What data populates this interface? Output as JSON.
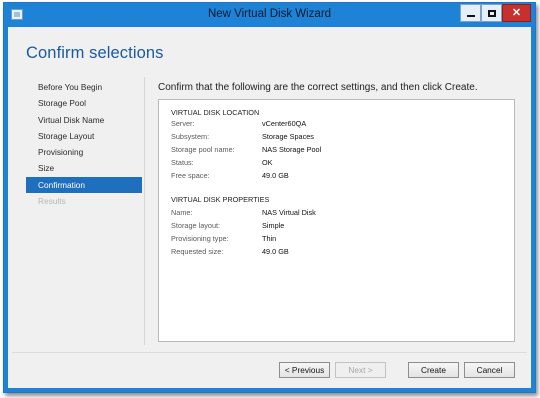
{
  "window": {
    "title": "New Virtual Disk Wizard",
    "close_glyph": "✕"
  },
  "page": {
    "title": "Confirm selections",
    "instruction": "Confirm that the following are the correct settings, and then click Create."
  },
  "nav": {
    "items": [
      {
        "label": "Before You Begin",
        "state": "normal"
      },
      {
        "label": "Storage Pool",
        "state": "normal"
      },
      {
        "label": "Virtual Disk Name",
        "state": "normal"
      },
      {
        "label": "Storage Layout",
        "state": "normal"
      },
      {
        "label": "Provisioning",
        "state": "normal"
      },
      {
        "label": "Size",
        "state": "normal"
      },
      {
        "label": "Confirmation",
        "state": "active"
      },
      {
        "label": "Results",
        "state": "disabled"
      }
    ]
  },
  "location": {
    "heading": "VIRTUAL DISK LOCATION",
    "rows": [
      {
        "name": "Server:",
        "value": "vCenter60QA"
      },
      {
        "name": "Subsystem:",
        "value": "Storage Spaces"
      },
      {
        "name": "Storage pool name:",
        "value": "NAS Storage Pool"
      },
      {
        "name": "Status:",
        "value": "OK"
      },
      {
        "name": "Free space:",
        "value": "49.0 GB"
      }
    ]
  },
  "properties": {
    "heading": "VIRTUAL DISK PROPERTIES",
    "rows": [
      {
        "name": "Name:",
        "value": "NAS Virtual Disk"
      },
      {
        "name": "Storage layout:",
        "value": "Simple"
      },
      {
        "name": "Provisioning type:",
        "value": "Thin"
      },
      {
        "name": "Requested size:",
        "value": "49.0 GB"
      }
    ]
  },
  "buttons": {
    "previous": "< Previous",
    "next": "Next >",
    "create": "Create",
    "cancel": "Cancel"
  },
  "colors": {
    "titlebar": "#1e82d6",
    "page_title": "#1a5aa0",
    "nav_active": "#1f6fbf",
    "close_button": "#c7302c"
  }
}
